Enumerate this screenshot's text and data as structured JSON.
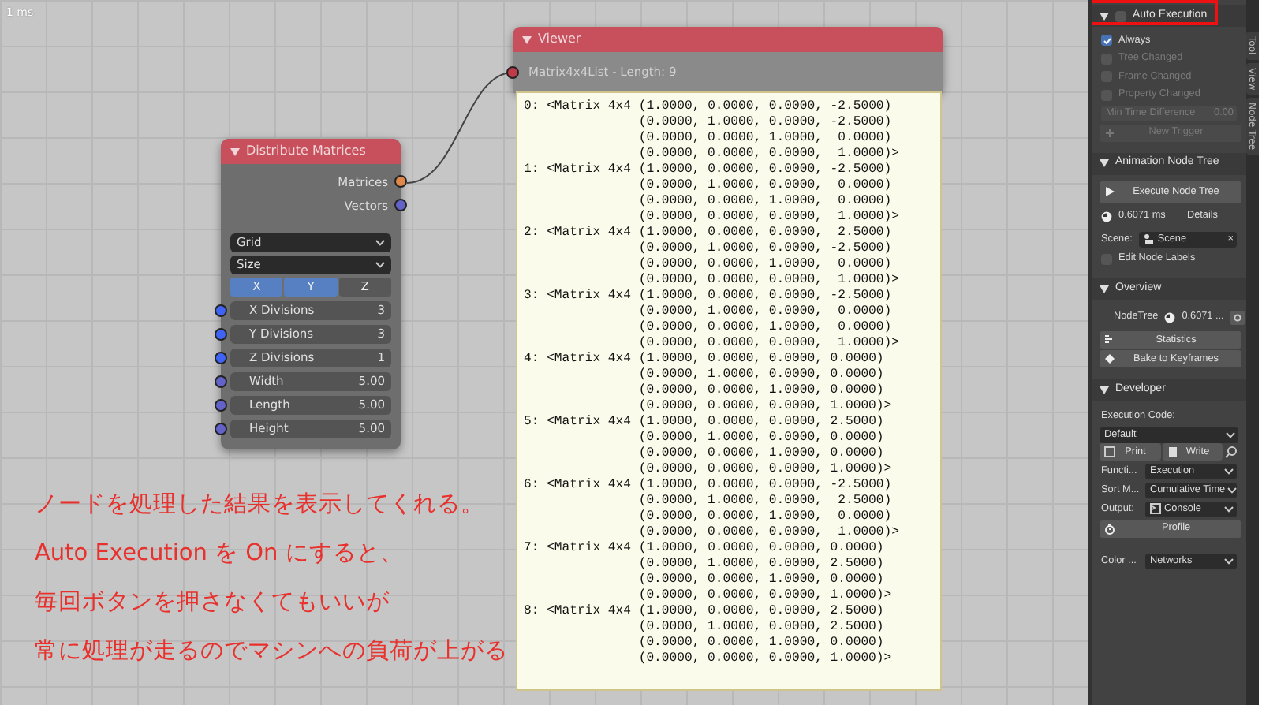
{
  "canvas": {
    "corner_label": "1 ms",
    "distribute_node": {
      "title": "Distribute Matrices",
      "expanded": true,
      "outputs": [
        {
          "label": "Matrices",
          "color": "#e0884a"
        },
        {
          "label": "Vectors",
          "color": "#6262c8"
        }
      ],
      "selects": [
        "Grid",
        "Size"
      ],
      "axes": [
        {
          "label": "X",
          "selected": true
        },
        {
          "label": "Y",
          "selected": true
        },
        {
          "label": "Z",
          "selected": false
        }
      ],
      "inputs": [
        {
          "label": "X Divisions",
          "value": "3",
          "color": "#3f64f5"
        },
        {
          "label": "Y Divisions",
          "value": "3",
          "color": "#3f64f5"
        },
        {
          "label": "Z Divisions",
          "value": "1",
          "color": "#3f64f5"
        },
        {
          "label": "Width",
          "value": "5.00",
          "color": "#6262c8"
        },
        {
          "label": "Length",
          "value": "5.00",
          "color": "#6262c8"
        },
        {
          "label": "Height",
          "value": "5.00",
          "color": "#6262c8"
        }
      ]
    },
    "viewer_node": {
      "title": "Viewer",
      "expanded": true,
      "input_label": "Matrix4x4List - Length: 9",
      "matrices": [
        {
          "lines": [
            "0: <Matrix 4x4 (1.0000, 0.0000, 0.0000, -2.5000)",
            "(0.0000, 1.0000, 0.0000, -2.5000)",
            "(0.0000, 0.0000, 1.0000,  0.0000)",
            "(0.0000, 0.0000, 0.0000,  1.0000)>"
          ]
        },
        {
          "lines": [
            "1: <Matrix 4x4 (1.0000, 0.0000, 0.0000, -2.5000)",
            "(0.0000, 1.0000, 0.0000,  0.0000)",
            "(0.0000, 0.0000, 1.0000,  0.0000)",
            "(0.0000, 0.0000, 0.0000,  1.0000)>"
          ]
        },
        {
          "lines": [
            "2: <Matrix 4x4 (1.0000, 0.0000, 0.0000,  2.5000)",
            "(0.0000, 1.0000, 0.0000, -2.5000)",
            "(0.0000, 0.0000, 1.0000,  0.0000)",
            "(0.0000, 0.0000, 0.0000,  1.0000)>"
          ]
        },
        {
          "lines": [
            "3: <Matrix 4x4 (1.0000, 0.0000, 0.0000, -2.5000)",
            "(0.0000, 1.0000, 0.0000,  0.0000)",
            "(0.0000, 0.0000, 1.0000,  0.0000)",
            "(0.0000, 0.0000, 0.0000,  1.0000)>"
          ]
        },
        {
          "lines": [
            "4: <Matrix 4x4 (1.0000, 0.0000, 0.0000, 0.0000)",
            "(0.0000, 1.0000, 0.0000, 0.0000)",
            "(0.0000, 0.0000, 1.0000, 0.0000)",
            "(0.0000, 0.0000, 0.0000, 1.0000)>"
          ]
        },
        {
          "lines": [
            "5: <Matrix 4x4 (1.0000, 0.0000, 0.0000, 2.5000)",
            "(0.0000, 1.0000, 0.0000, 0.0000)",
            "(0.0000, 0.0000, 1.0000, 0.0000)",
            "(0.0000, 0.0000, 0.0000, 1.0000)>"
          ]
        },
        {
          "lines": [
            "6: <Matrix 4x4 (1.0000, 0.0000, 0.0000, -2.5000)",
            "(0.0000, 1.0000, 0.0000,  2.5000)",
            "(0.0000, 0.0000, 1.0000,  0.0000)",
            "(0.0000, 0.0000, 0.0000,  1.0000)>"
          ]
        },
        {
          "lines": [
            "7: <Matrix 4x4 (1.0000, 0.0000, 0.0000, 0.0000)",
            "(0.0000, 1.0000, 0.0000, 2.5000)",
            "(0.0000, 0.0000, 1.0000, 0.0000)",
            "(0.0000, 0.0000, 0.0000, 1.0000)>"
          ]
        },
        {
          "lines": [
            "8: <Matrix 4x4 (1.0000, 0.0000, 0.0000, 2.5000)",
            "(0.0000, 1.0000, 0.0000, 2.5000)",
            "(0.0000, 0.0000, 1.0000, 0.0000)",
            "(0.0000, 0.0000, 0.0000, 1.0000)>"
          ]
        }
      ]
    },
    "annotation": [
      "ノードを処理した結果を表示してくれる。",
      "Auto Execution を On にすると、",
      "毎回ボタンを押さなくてもいいが",
      "常に処理が走るのでマシンへの負荷が上がる"
    ]
  },
  "sidebar": {
    "sections": [
      {
        "title": "Auto Execution",
        "expanded": true,
        "highlighted": true,
        "enabled": {
          "checked": false
        },
        "items": [
          {
            "kind": "checkbox",
            "label": "Always",
            "checked": true,
            "disabled": false
          },
          {
            "kind": "checkbox",
            "label": "Tree Changed",
            "checked": false,
            "disabled": true
          },
          {
            "kind": "checkbox",
            "label": "Frame Changed",
            "checked": false,
            "disabled": true
          },
          {
            "kind": "checkbox",
            "label": "Property Changed",
            "checked": false,
            "disabled": true
          },
          {
            "kind": "number",
            "label": "Min Time Difference",
            "value": "0.00",
            "disabled": true
          },
          {
            "kind": "trigger",
            "label": "New Trigger",
            "disabled": true
          }
        ]
      },
      {
        "title": "Animation Node Tree",
        "expanded": true,
        "highlighted": false,
        "items": [
          {
            "kind": "execute",
            "label": "Execute Node Tree",
            "disabled": false
          },
          {
            "kind": "timing",
            "value": "0.6071 ms",
            "link": "Details"
          },
          {
            "kind": "scene",
            "label": "Scene:",
            "value": "Scene",
            "clear": "×"
          },
          {
            "kind": "checkbox",
            "label": "Edit Node Labels",
            "checked": false,
            "disabled": false
          }
        ]
      },
      {
        "title": "Overview",
        "expanded": true,
        "highlighted": false,
        "items": [
          {
            "kind": "nodetree",
            "label": "NodeTree",
            "value": "0.6071 ..."
          },
          {
            "kind": "statistics",
            "label": "Statistics",
            "disabled": false
          },
          {
            "kind": "bake",
            "label": "Bake to Keyframes",
            "disabled": false
          }
        ]
      },
      {
        "title": "Developer",
        "expanded": true,
        "highlighted": false,
        "items": [
          {
            "kind": "caption",
            "label": "Execution Code:"
          },
          {
            "kind": "select",
            "value": "Default"
          },
          {
            "kind": "pair",
            "buttons": [
              "Print",
              "Write"
            ]
          },
          {
            "kind": "select",
            "label": "Functi...",
            "value": "Execution"
          },
          {
            "kind": "select",
            "label": "Sort M...",
            "value": "Cumulative Time"
          },
          {
            "kind": "output",
            "label": "Output:",
            "value": "Console"
          },
          {
            "kind": "profile",
            "label": "Profile",
            "disabled": false
          },
          {
            "kind": "gap"
          },
          {
            "kind": "select",
            "label": "Color ...",
            "value": "Networks"
          }
        ]
      }
    ]
  },
  "tabs": [
    {
      "label": "Tool"
    },
    {
      "label": "View"
    },
    {
      "label": "Node Tree"
    }
  ]
}
